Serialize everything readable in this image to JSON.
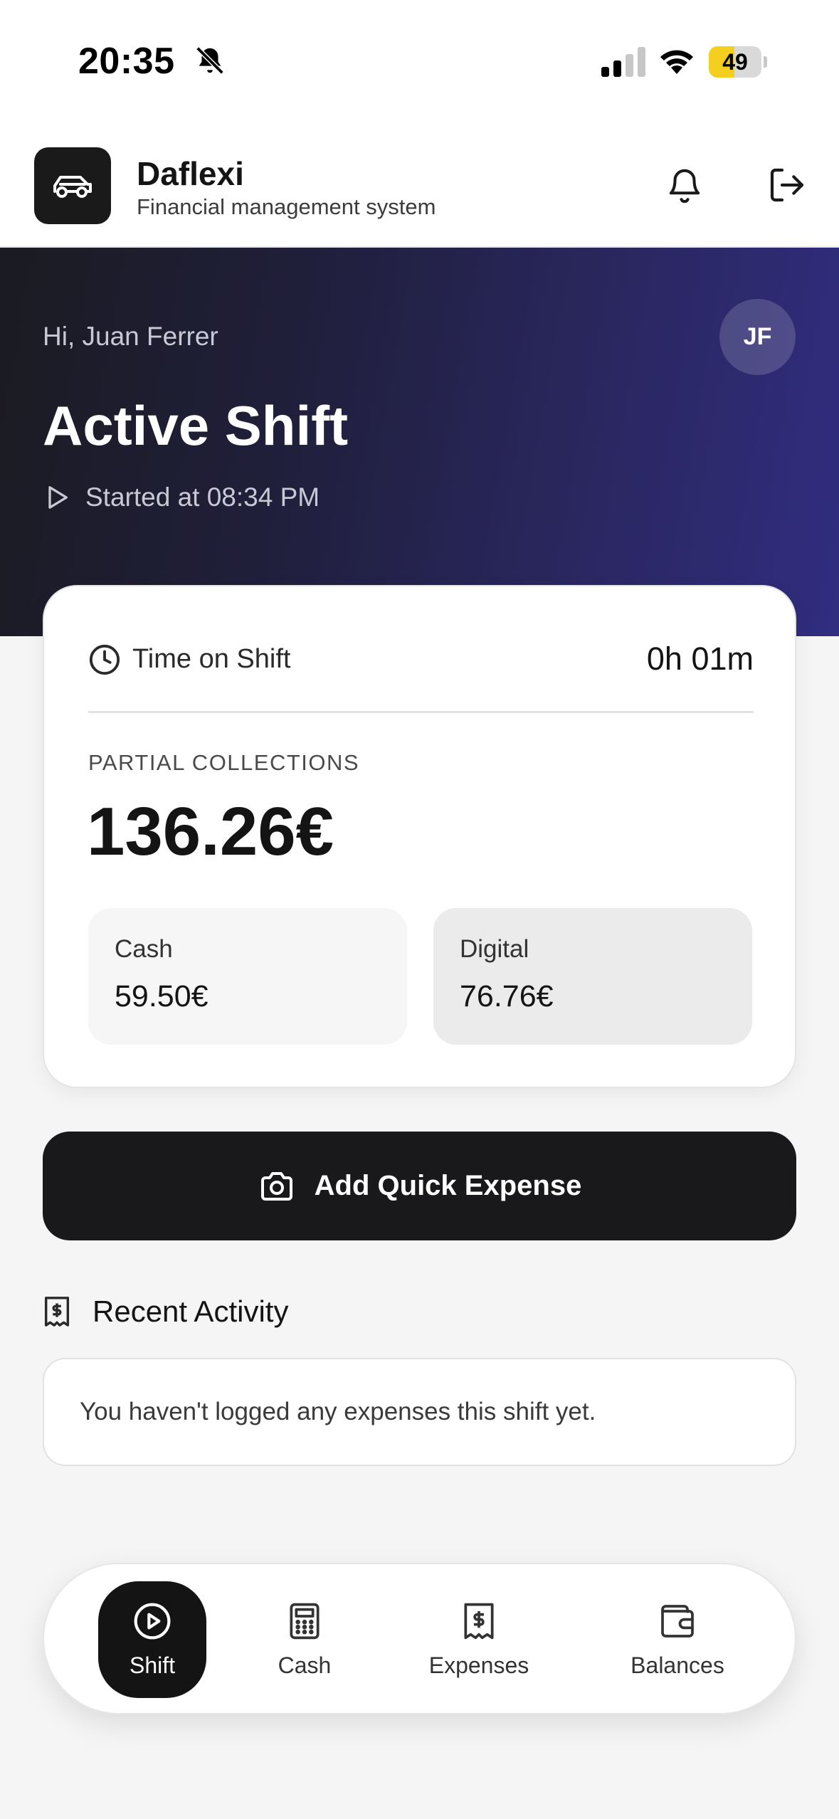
{
  "status_bar": {
    "time": "20:35",
    "battery_level": "49",
    "battery_fraction": 0.49,
    "icons": [
      "bell-slash-icon",
      "cellular-signal-icon",
      "wifi-icon",
      "battery-icon"
    ]
  },
  "header": {
    "title": "Daflexi",
    "subtitle": "Financial management system",
    "logo_icon": "car-icon",
    "actions": [
      "bell-icon",
      "logout-icon"
    ]
  },
  "hero": {
    "greeting": "Hi, Juan Ferrer",
    "avatar_initials": "JF",
    "title": "Active Shift",
    "started_text": "Started at 08:34 PM",
    "gradient_colors": [
      "#1b1b22",
      "#312d80"
    ]
  },
  "shift_card": {
    "time_label": "Time on Shift",
    "time_value": "0h 01m",
    "partial_label": "PARTIAL COLLECTIONS",
    "total": "136.26€",
    "cash": {
      "label": "Cash",
      "value": "59.50€"
    },
    "digital": {
      "label": "Digital",
      "value": "76.76€"
    }
  },
  "quick_expense": {
    "label": "Add Quick Expense",
    "icon": "camera-icon"
  },
  "recent_activity": {
    "title": "Recent Activity",
    "icon": "receipt-icon",
    "empty_message": "You haven't logged any expenses this shift yet."
  },
  "nav": {
    "items": [
      {
        "label": "Shift",
        "icon": "play-circle-icon",
        "active": true
      },
      {
        "label": "Cash",
        "icon": "calculator-icon",
        "active": false
      },
      {
        "label": "Expenses",
        "icon": "receipt-icon",
        "active": false
      },
      {
        "label": "Balances",
        "icon": "wallet-icon",
        "active": false
      }
    ]
  },
  "colors": {
    "accent_dark": "#141414",
    "background": "#f5f5f5",
    "battery_yellow": "#f5cf1e"
  }
}
